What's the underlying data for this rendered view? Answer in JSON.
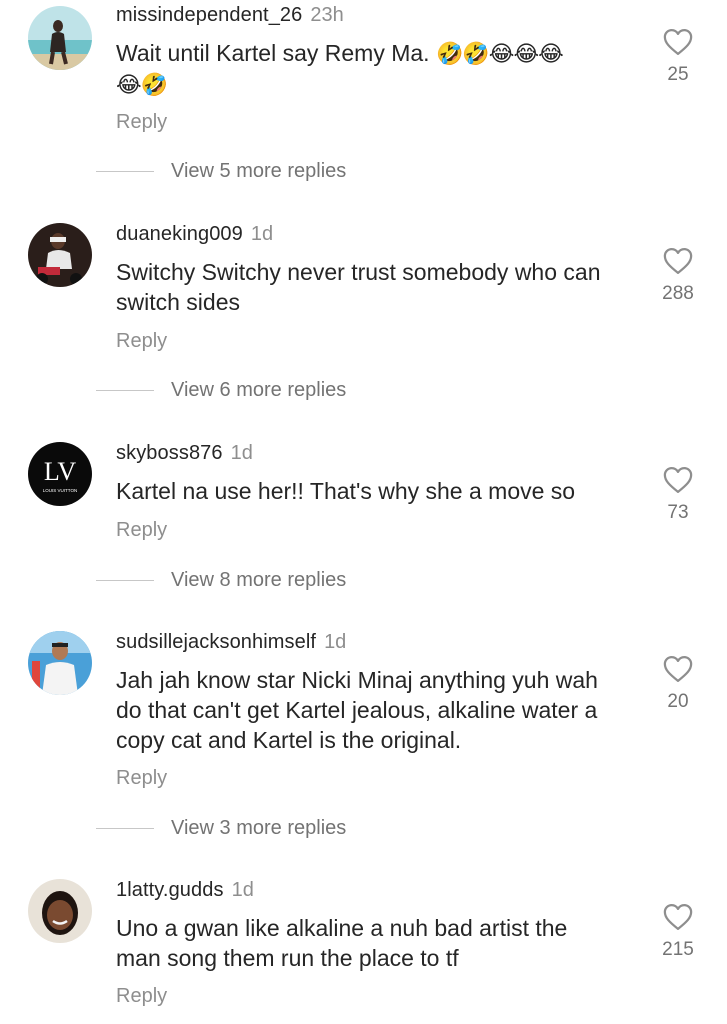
{
  "comments": [
    {
      "username": "missindependent_26",
      "time": "23h",
      "text": "Wait until Kartel say Remy Ma.",
      "emojis_line1": "🤣🤣😂😂😂",
      "emojis_line2": "😂🤣",
      "reply": "Reply",
      "view_replies": "View 5 more replies",
      "likes": "25"
    },
    {
      "username": "duaneking009",
      "time": "1d",
      "text": "Switchy Switchy never trust somebody who can switch sides",
      "reply": "Reply",
      "view_replies": "View 6 more replies",
      "likes": "288"
    },
    {
      "username": "skyboss876",
      "time": "1d",
      "text": "Kartel na use her!! That's why she a move so",
      "reply": "Reply",
      "view_replies": "View 8 more replies",
      "likes": "73",
      "avatar_logo": "LV",
      "avatar_caption": "LOUIS VUITTON"
    },
    {
      "username": "sudsillejacksonhimself",
      "time": "1d",
      "text": "Jah jah know star Nicki Minaj anything yuh wah do that can't get Kartel jealous, alkaline water a copy cat and Kartel is the original.",
      "reply": "Reply",
      "view_replies": "View 3 more replies",
      "likes": "20"
    },
    {
      "username": "1latty.gudds",
      "time": "1d",
      "text": "Uno a gwan like alkaline a nuh bad artist the man song them run the place to tf",
      "reply": "Reply",
      "likes": "215"
    }
  ],
  "icons": {
    "like": "heart-outline-icon"
  },
  "colors": {
    "primary_text": "#262626",
    "secondary_text": "#8e8e8e",
    "divider": "#c7c7c7"
  }
}
